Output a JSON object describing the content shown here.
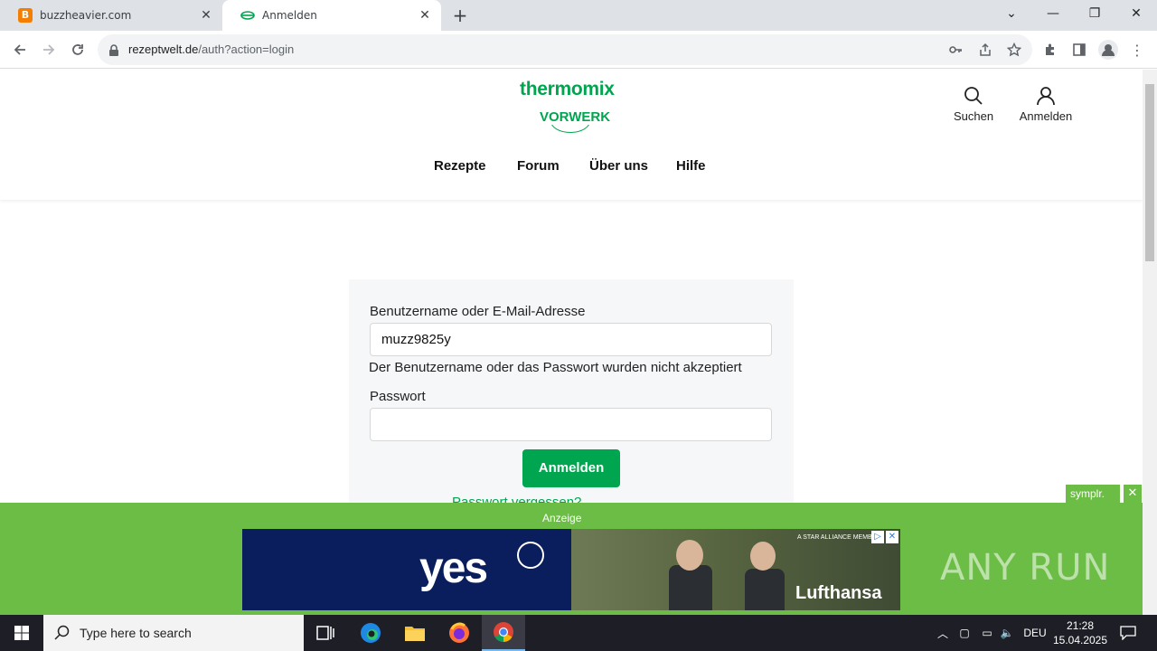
{
  "browser": {
    "tabs": [
      {
        "title": "buzzheavier.com",
        "favicon_letter": "B"
      },
      {
        "title": "Anmelden"
      }
    ],
    "url_host": "rezeptwelt.de",
    "url_path": "/auth?action=login"
  },
  "site": {
    "logo_top": "thermomix",
    "logo_bottom": "VORWERK",
    "header_actions": [
      {
        "label": "Suchen",
        "icon": "search-icon"
      },
      {
        "label": "Anmelden",
        "icon": "user-icon"
      }
    ],
    "nav": [
      "Rezepte",
      "Forum",
      "Über uns",
      "Hilfe"
    ]
  },
  "login": {
    "username_label": "Benutzername oder E-Mail-Adresse",
    "username_value": "muzz9825y",
    "error_text": "Der Benutzername oder das Passwort wurden nicht akzeptiert",
    "password_label": "Passwort",
    "password_value": "",
    "submit_label": "Anmelden",
    "forgot_partial": "Passwort vergessen?"
  },
  "ad": {
    "badge": "symplr.",
    "label": "Anzeige",
    "headline": "yes",
    "brand": "Lufthansa",
    "alliance": "A STAR ALLIANCE MEMBER",
    "watermark": "ANY RUN"
  },
  "taskbar": {
    "search_placeholder": "Type here to search",
    "language": "DEU",
    "time": "21:28",
    "date": "15.04.2025"
  },
  "colors": {
    "brand_green": "#00a54f",
    "ad_green": "#6cbd45"
  }
}
